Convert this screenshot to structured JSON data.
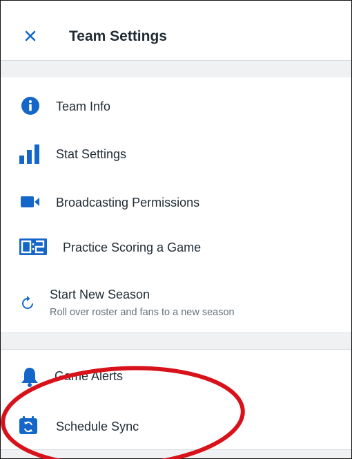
{
  "header": {
    "title": "Team Settings",
    "close_icon": "close-icon"
  },
  "menu": {
    "team_info": {
      "label": "Team Info",
      "icon": "info-icon"
    },
    "stat_settings": {
      "label": "Stat Settings",
      "icon": "bar-chart-icon"
    },
    "broadcasting": {
      "label": "Broadcasting Permissions",
      "icon": "video-camera-icon"
    },
    "practice": {
      "label": "Practice Scoring a Game",
      "icon": "scoreboard-icon"
    },
    "new_season": {
      "label": "Start New Season",
      "sublabel": "Roll over roster and fans to a new season",
      "icon": "refresh-icon"
    },
    "game_alerts": {
      "label": "Game Alerts",
      "icon": "bell-icon"
    },
    "schedule_sync": {
      "label": "Schedule Sync",
      "icon": "calendar-sync-icon"
    }
  },
  "colors": {
    "accent": "#1466c8",
    "annotation": "#d8121b",
    "section_gap": "#eff1f3"
  }
}
